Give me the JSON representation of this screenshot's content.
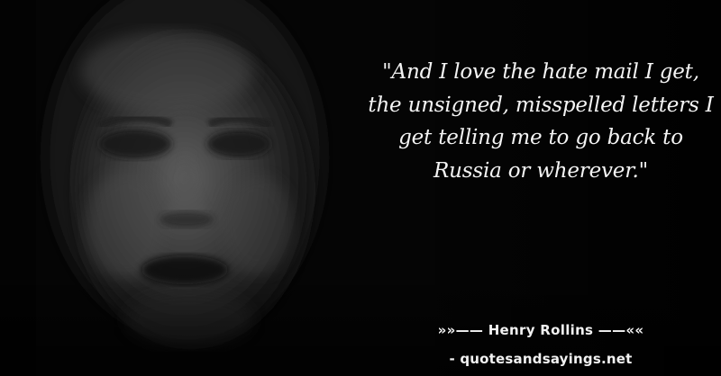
{
  "quote": {
    "text": "\"And I love the hate mail I get, the unsigned, misspelled letters I get telling me to go back to Russia or wherever.\""
  },
  "attribution": {
    "line": "»»—— Henry Rollins ——««"
  },
  "source": {
    "line": "- quotesandsayings.net"
  },
  "colors": {
    "background": "#050505",
    "text": "#f4f4f4"
  }
}
